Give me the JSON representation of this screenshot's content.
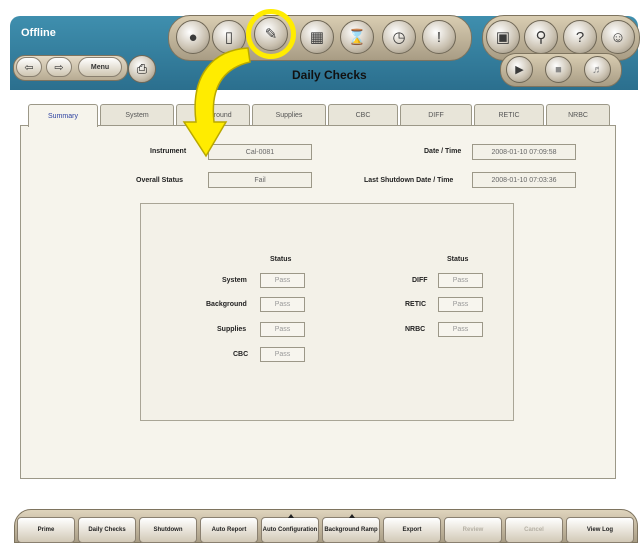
{
  "header": {
    "status": "Offline",
    "screen_title": "Daily Checks"
  },
  "nav": {
    "back_icon": "back-arrow-icon",
    "forward_icon": "forward-arrow-icon",
    "menu_label": "Menu",
    "print_icon": "printer-icon"
  },
  "toolbar": {
    "icons": [
      "sample-group-icon",
      "reagent-bottle-icon",
      "daily-checks-icon",
      "data-grid-icon",
      "hourglass-icon",
      "gauge-icon",
      "alert-icon"
    ],
    "right_icons": [
      "lock-icon",
      "search-icon",
      "help-icon",
      "user-icon"
    ],
    "run_icons": [
      "play-icon",
      "stop-icon",
      "volume-icon"
    ]
  },
  "tabs": [
    "Summary",
    "System",
    "Background",
    "Supplies",
    "CBC",
    "DIFF",
    "RETIC",
    "NRBC"
  ],
  "summary": {
    "instrument_label": "Instrument",
    "instrument_value": "Cal-0081",
    "overall_status_label": "Overall Status",
    "overall_status_value": "Fail",
    "datetime_label": "Date / Time",
    "datetime_value": "2008-01-10 07:09:58",
    "last_shutdown_label": "Last Shutdown Date / Time",
    "last_shutdown_value": "2008-01-10 07:03:36"
  },
  "status_table": {
    "left_header": "Status",
    "right_header": "Status",
    "left": [
      {
        "label": "System",
        "value": "Pass"
      },
      {
        "label": "Background",
        "value": "Pass"
      },
      {
        "label": "Supplies",
        "value": "Pass"
      },
      {
        "label": "CBC",
        "value": "Pass"
      }
    ],
    "right": [
      {
        "label": "DIFF",
        "value": "Pass"
      },
      {
        "label": "RETIC",
        "value": "Pass"
      },
      {
        "label": "NRBC",
        "value": "Pass"
      }
    ]
  },
  "bottom_buttons": [
    {
      "label": "Prime"
    },
    {
      "label": "Daily Checks"
    },
    {
      "label": "Shutdown"
    },
    {
      "label": "Auto Report"
    },
    {
      "label": "Auto Configuration"
    },
    {
      "label": "Background Ramp"
    },
    {
      "label": "Export"
    },
    {
      "label": "Review"
    },
    {
      "label": "Cancel"
    },
    {
      "label": "View Log"
    }
  ],
  "colors": {
    "header": "#3f8fae",
    "highlight": "#ffec00",
    "panel": "#f6f4ec",
    "active_tab_text": "#2a3fa0"
  }
}
